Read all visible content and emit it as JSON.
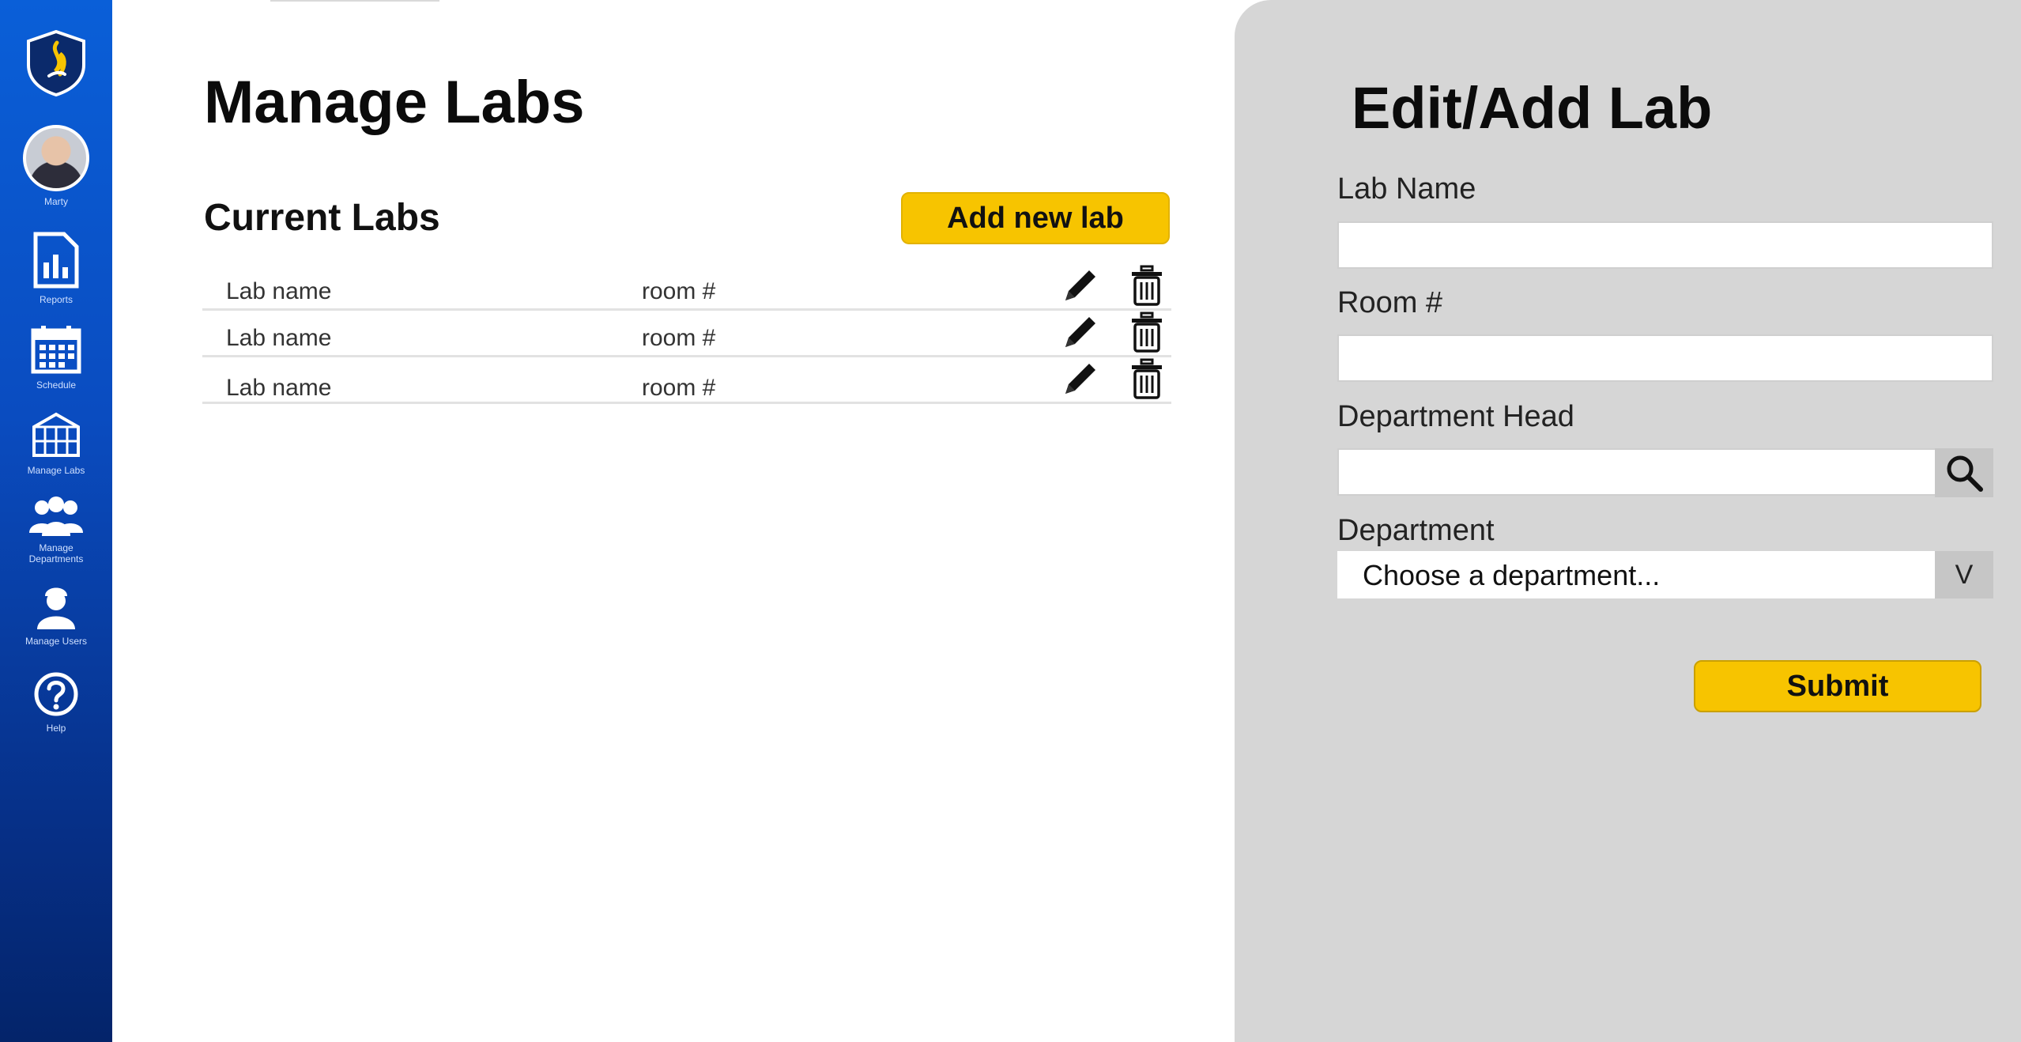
{
  "sidebar": {
    "user_name": "Marty",
    "items": [
      {
        "label": "Reports",
        "icon": "report-chart-icon"
      },
      {
        "label": "Schedule",
        "icon": "calendar-icon"
      },
      {
        "label": "Manage Labs",
        "icon": "lab-building-icon"
      },
      {
        "label": "Manage\nDepartments",
        "icon": "people-group-icon"
      },
      {
        "label": "Manage Users",
        "icon": "user-icon"
      },
      {
        "label": "Help",
        "icon": "help-icon"
      }
    ]
  },
  "main": {
    "title": "Manage Labs",
    "section_title": "Current Labs",
    "add_button": "Add new lab",
    "labs": [
      {
        "name": "Lab name",
        "room": "room #"
      },
      {
        "name": "Lab name",
        "room": "room #"
      },
      {
        "name": "Lab name",
        "room": "room #"
      }
    ]
  },
  "form": {
    "title": "Edit/Add Lab",
    "lab_name_label": "Lab Name",
    "lab_name_value": "",
    "room_label": "Room #",
    "room_value": "",
    "dept_head_label": "Department Head",
    "dept_head_value": "",
    "department_label": "Department",
    "department_selected": "Choose a department...",
    "dropdown_arrow": "V",
    "submit": "Submit"
  },
  "colors": {
    "accent_yellow": "#f7c400",
    "sidebar_blue": "#0a4cc0",
    "panel_gray": "#d6d6d6"
  }
}
